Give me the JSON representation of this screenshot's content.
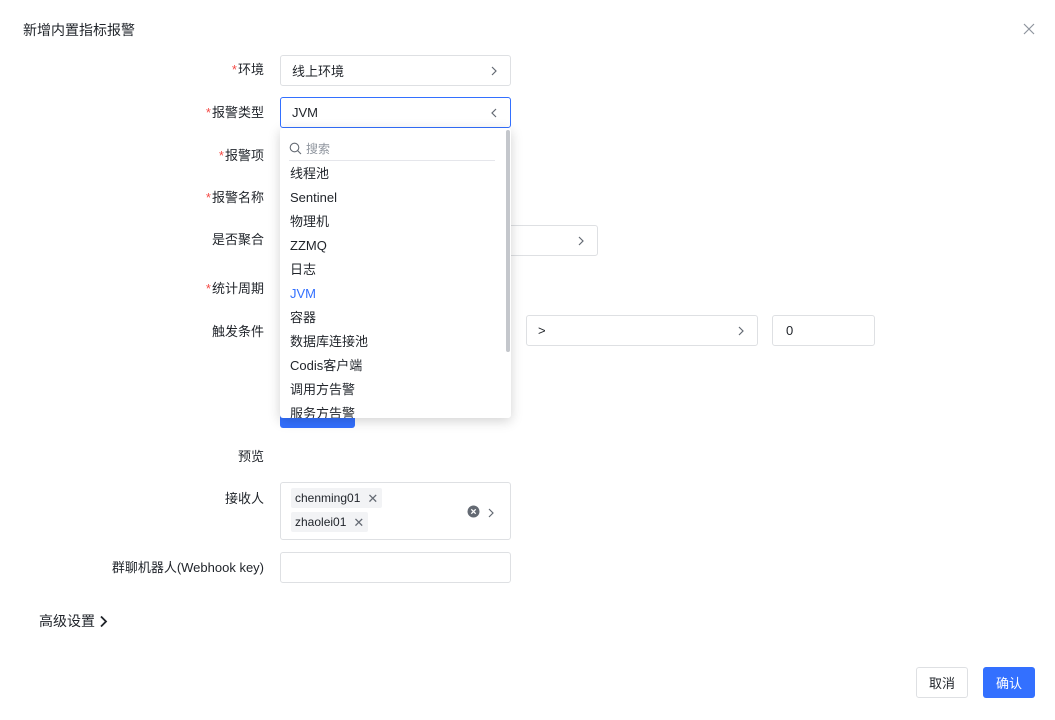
{
  "dialog": {
    "title": "新增内置指标报警"
  },
  "form": {
    "env": {
      "label": "环境",
      "value": "线上环境"
    },
    "alert_type": {
      "label": "报警类型",
      "value": "JVM"
    },
    "alert_item": {
      "label": "报警项"
    },
    "alert_name": {
      "label": "报警名称"
    },
    "aggregate": {
      "label": "是否聚合"
    },
    "period": {
      "label": "统计周期"
    },
    "trigger": {
      "label": "触发条件",
      "operator": ">",
      "threshold": "0"
    },
    "preview": {
      "label": "预览"
    },
    "receivers": {
      "label": "接收人",
      "tags": [
        "chenming01",
        "zhaolei01"
      ]
    },
    "webhook": {
      "label": "群聊机器人(Webhook key)",
      "value": ""
    },
    "required_mark": "*"
  },
  "dropdown": {
    "search_placeholder": "搜索",
    "options": [
      "线程池",
      "Sentinel",
      "物理机",
      "ZZMQ",
      "日志",
      "JVM",
      "容器",
      "数据库连接池",
      "Codis客户端",
      "调用方告警",
      "服务方告警"
    ],
    "selected": "JVM"
  },
  "advanced": {
    "label": "高级设置"
  },
  "footer": {
    "cancel": "取消",
    "ok": "确认"
  },
  "colors": {
    "primary": "#3370ff",
    "required": "#f54a45",
    "border": "#dee0e3"
  }
}
